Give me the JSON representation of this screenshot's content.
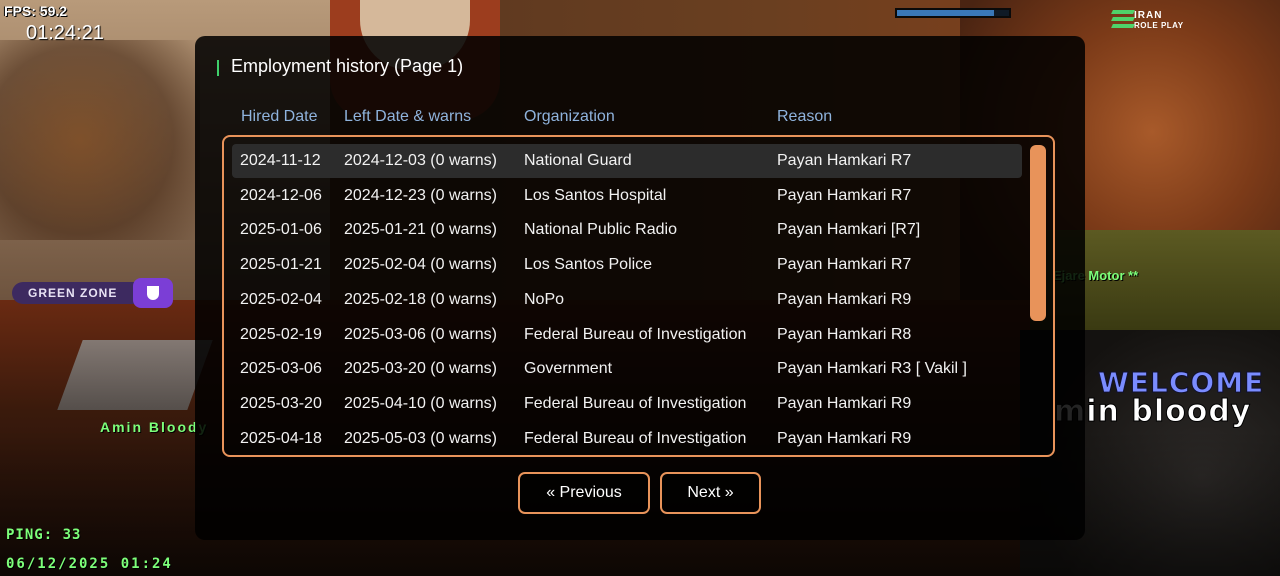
{
  "hud": {
    "fps": "FPS: 59.2",
    "clock": "01:24:21",
    "ping": "PING: 33",
    "datetime": "06/12/2025 01:24",
    "health_fraction": 0.87,
    "logo_line1": "IRAN",
    "logo_line2": "ROLE PLAY",
    "zone_label": "GREEN ZONE",
    "player_nametag": "Amin Bloody",
    "right_tag": "Ejare Motor **",
    "welcome": "WELCOME",
    "big_name": "min bloody",
    "colors": {
      "zone_bg": "#3d2a60",
      "zone_accent": "#7b3ed6",
      "hud_green": "#7dff7a",
      "welcome": "#7a8cff"
    }
  },
  "dialog": {
    "title": "Employment history (Page 1)",
    "title_accent": "#3fd06b",
    "header_color": "#8fb3dd",
    "border_color": "#e8935a",
    "columns": [
      "Hired Date",
      "Left Date & warns",
      "Organization",
      "Reason"
    ],
    "rows": [
      {
        "hired": "2024-11-12",
        "left": "2024-12-03 (0 warns)",
        "org": "National Guard",
        "reason": "Payan Hamkari R7"
      },
      {
        "hired": "2024-12-06",
        "left": "2024-12-23 (0 warns)",
        "org": "Los Santos Hospital",
        "reason": "Payan Hamkari R7"
      },
      {
        "hired": "2025-01-06",
        "left": "2025-01-21 (0 warns)",
        "org": "National Public Radio",
        "reason": "Payan Hamkari [R7]"
      },
      {
        "hired": "2025-01-21",
        "left": "2025-02-04 (0 warns)",
        "org": "Los Santos Police",
        "reason": "Payan Hamkari R7"
      },
      {
        "hired": "2025-02-04",
        "left": "2025-02-18 (0 warns)",
        "org": "NoPo",
        "reason": "Payan Hamkari R9"
      },
      {
        "hired": "2025-02-19",
        "left": "2025-03-06 (0 warns)",
        "org": "Federal Bureau of Investigation",
        "reason": "Payan Hamkari R8"
      },
      {
        "hired": "2025-03-06",
        "left": "2025-03-20 (0 warns)",
        "org": "Government",
        "reason": "Payan Hamkari R3 [ Vakil ]"
      },
      {
        "hired": "2025-03-20",
        "left": "2025-04-10 (0 warns)",
        "org": "Federal Bureau of Investigation",
        "reason": "Payan Hamkari R9"
      },
      {
        "hired": "2025-04-18",
        "left": "2025-05-03 (0 warns)",
        "org": "Federal Bureau of Investigation",
        "reason": "Payan Hamkari R9"
      }
    ],
    "selected_row": 0,
    "prev_label": "« Previous",
    "next_label": "Next »"
  }
}
